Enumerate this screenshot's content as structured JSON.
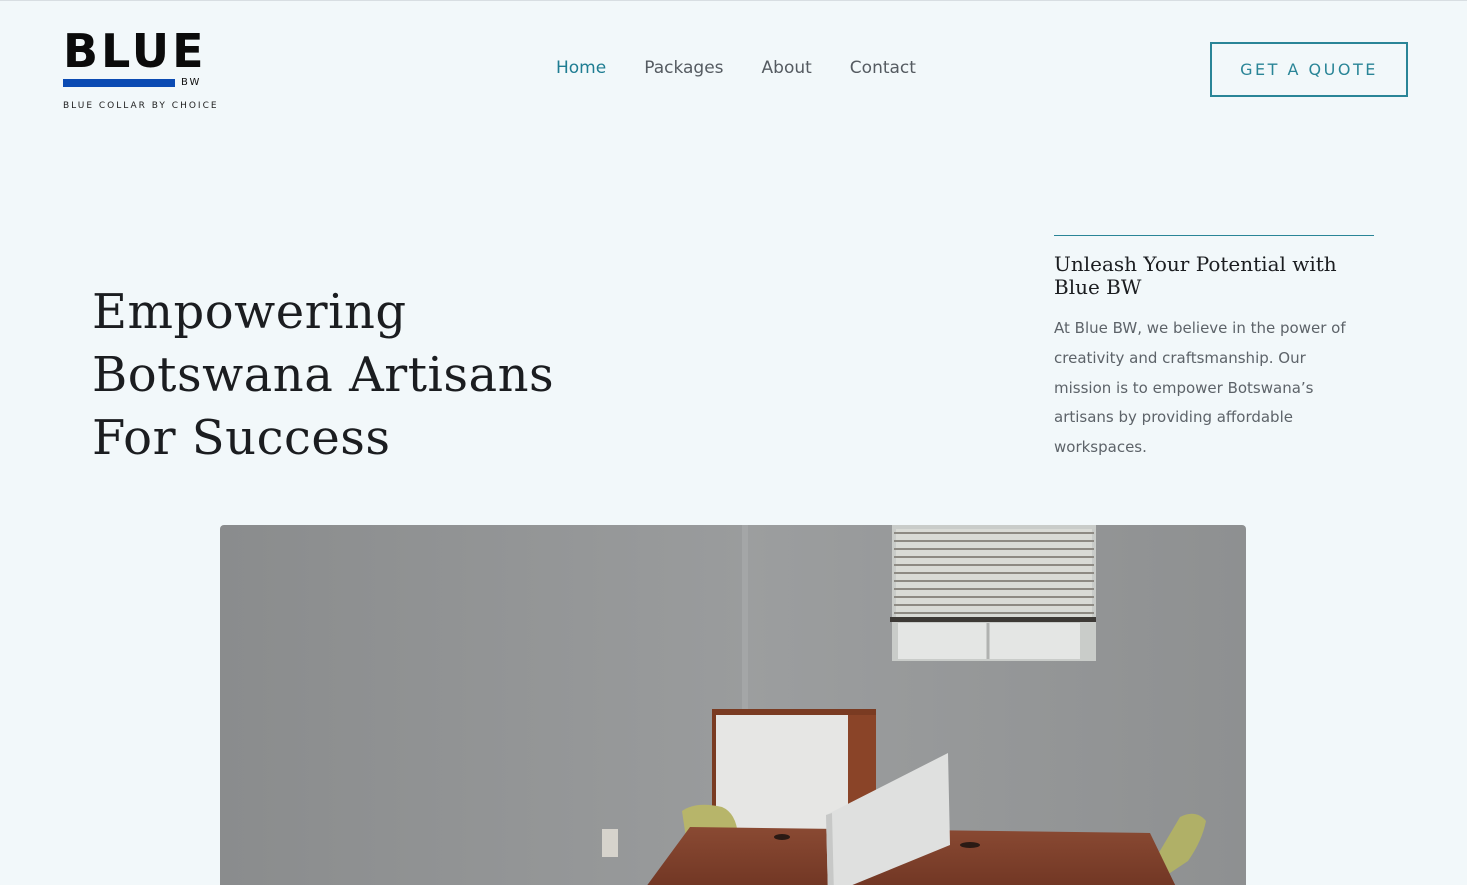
{
  "brand": {
    "logo_word": "BLUE",
    "logo_sub": "BW",
    "tagline": "BLUE COLLAR BY CHOICE",
    "logo_bar_color": "#0b4bb3"
  },
  "nav": {
    "items": [
      {
        "label": "Home",
        "active": true
      },
      {
        "label": "Packages",
        "active": false
      },
      {
        "label": "About",
        "active": false
      },
      {
        "label": "Contact",
        "active": false
      }
    ]
  },
  "cta": {
    "label": "GET A QUOTE"
  },
  "hero": {
    "title_lines": [
      "Empowering",
      "Botswana Artisans",
      "For Success"
    ]
  },
  "side": {
    "heading": "Unleash Your Potential with Blue BW",
    "body": "At Blue BW, we believe in the power of creativity and craftsmanship. Our mission is to empower Botswana’s artisans by providing affordable workspaces."
  },
  "photo": {
    "subject": "office-room-photo"
  },
  "colors": {
    "background": "#f2f8fa",
    "accent": "#2a8597",
    "nav_active": "#1f7d92",
    "text_dark": "#1b1d20",
    "text_muted": "#5d6369"
  }
}
